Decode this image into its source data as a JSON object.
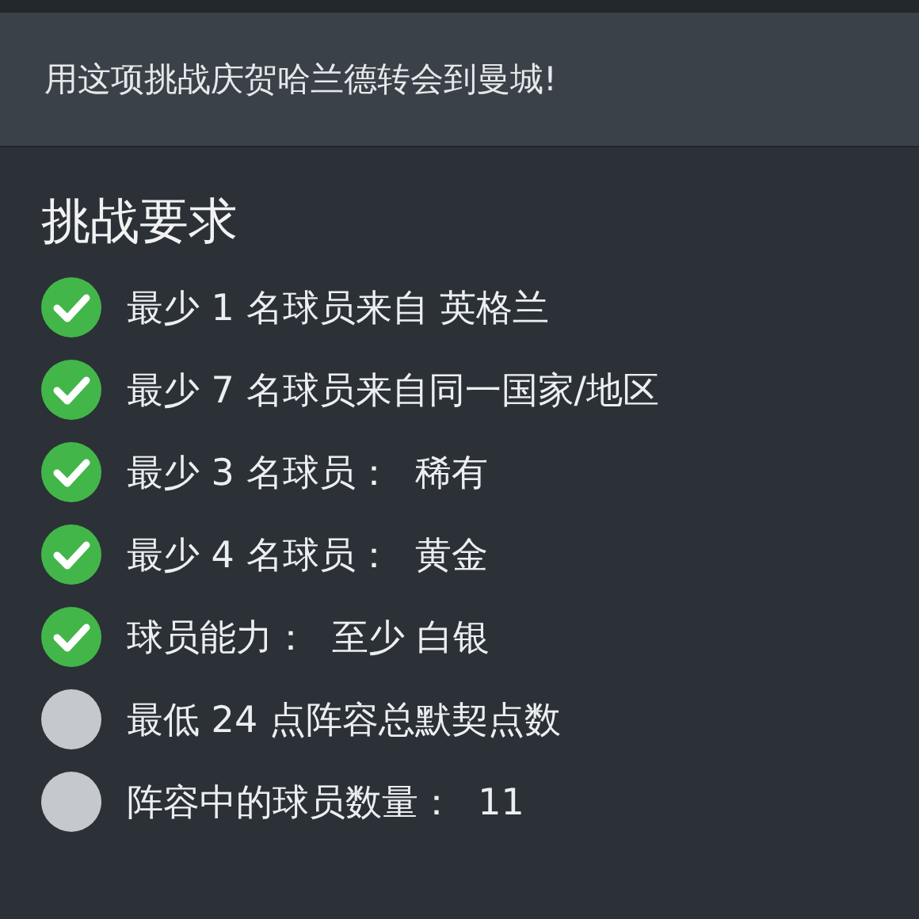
{
  "banner": {
    "text": "用这项挑战庆贺哈兰德转会到曼城!"
  },
  "requirements": {
    "title": "挑战要求",
    "items": [
      {
        "text": "最少 1 名球员来自 英格兰",
        "checked": true
      },
      {
        "text": "最少 7 名球员来自同一国家/地区",
        "checked": true
      },
      {
        "text": "最少 3 名球员：  稀有",
        "checked": true
      },
      {
        "text": "最少 4 名球员：  黄金",
        "checked": true
      },
      {
        "text": "球员能力：  至少 白银",
        "checked": true
      },
      {
        "text": "最低 24 点阵容总默契点数",
        "checked": false
      },
      {
        "text": "阵容中的球员数量：  11",
        "checked": false
      }
    ]
  }
}
